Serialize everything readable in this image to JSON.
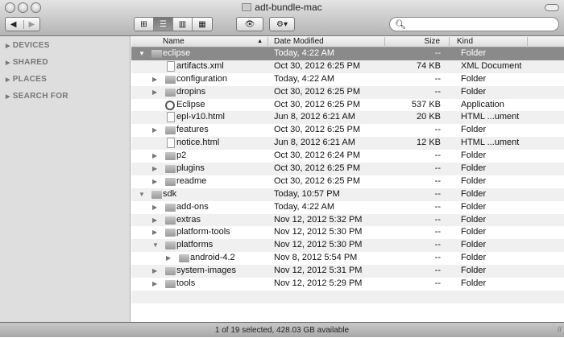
{
  "window": {
    "title": "adt-bundle-mac"
  },
  "toolbar": {
    "back": "◀",
    "forward": "▶",
    "view_icon": "⊞",
    "view_list": "☰",
    "view_column": "▥",
    "view_coverflow": "▦",
    "quicklook": "👁",
    "action": "⚙▾",
    "search_placeholder": "",
    "search_value": ""
  },
  "sidebar": {
    "sections": [
      "DEVICES",
      "SHARED",
      "PLACES",
      "SEARCH FOR"
    ]
  },
  "columns": {
    "name": "Name",
    "date": "Date Modified",
    "size": "Size",
    "kind": "Kind"
  },
  "rows": [
    {
      "name": "eclipse",
      "date": "Today, 4:22 AM",
      "size": "--",
      "kind": "Folder",
      "level": 0,
      "type": "folder",
      "disclosure": "open",
      "selected": true
    },
    {
      "name": "artifacts.xml",
      "date": "Oct 30, 2012 6:25 PM",
      "size": "74 KB",
      "kind": "XML Document",
      "level": 1,
      "type": "file"
    },
    {
      "name": "configuration",
      "date": "Today, 4:22 AM",
      "size": "--",
      "kind": "Folder",
      "level": 1,
      "type": "folder",
      "disclosure": "closed"
    },
    {
      "name": "dropins",
      "date": "Oct 30, 2012 6:25 PM",
      "size": "--",
      "kind": "Folder",
      "level": 1,
      "type": "folder",
      "disclosure": "closed"
    },
    {
      "name": "Eclipse",
      "date": "Oct 30, 2012 6:25 PM",
      "size": "537 KB",
      "kind": "Application",
      "level": 1,
      "type": "app"
    },
    {
      "name": "epl-v10.html",
      "date": "Jun 8, 2012 6:21 AM",
      "size": "20 KB",
      "kind": "HTML ...ument",
      "level": 1,
      "type": "file"
    },
    {
      "name": "features",
      "date": "Oct 30, 2012 6:25 PM",
      "size": "--",
      "kind": "Folder",
      "level": 1,
      "type": "folder",
      "disclosure": "closed"
    },
    {
      "name": "notice.html",
      "date": "Jun 8, 2012 6:21 AM",
      "size": "12 KB",
      "kind": "HTML ...ument",
      "level": 1,
      "type": "file"
    },
    {
      "name": "p2",
      "date": "Oct 30, 2012 6:24 PM",
      "size": "--",
      "kind": "Folder",
      "level": 1,
      "type": "folder",
      "disclosure": "closed"
    },
    {
      "name": "plugins",
      "date": "Oct 30, 2012 6:25 PM",
      "size": "--",
      "kind": "Folder",
      "level": 1,
      "type": "folder",
      "disclosure": "closed"
    },
    {
      "name": "readme",
      "date": "Oct 30, 2012 6:25 PM",
      "size": "--",
      "kind": "Folder",
      "level": 1,
      "type": "folder",
      "disclosure": "closed"
    },
    {
      "name": "sdk",
      "date": "Today, 10:57 PM",
      "size": "--",
      "kind": "Folder",
      "level": 0,
      "type": "folder",
      "disclosure": "open"
    },
    {
      "name": "add-ons",
      "date": "Today, 4:22 AM",
      "size": "--",
      "kind": "Folder",
      "level": 1,
      "type": "folder",
      "disclosure": "closed"
    },
    {
      "name": "extras",
      "date": "Nov 12, 2012 5:32 PM",
      "size": "--",
      "kind": "Folder",
      "level": 1,
      "type": "folder",
      "disclosure": "closed"
    },
    {
      "name": "platform-tools",
      "date": "Nov 12, 2012 5:30 PM",
      "size": "--",
      "kind": "Folder",
      "level": 1,
      "type": "folder",
      "disclosure": "closed"
    },
    {
      "name": "platforms",
      "date": "Nov 12, 2012 5:30 PM",
      "size": "--",
      "kind": "Folder",
      "level": 1,
      "type": "folder",
      "disclosure": "open"
    },
    {
      "name": "android-4.2",
      "date": "Nov 8, 2012 5:54 PM",
      "size": "--",
      "kind": "Folder",
      "level": 2,
      "type": "folder",
      "disclosure": "closed"
    },
    {
      "name": "system-images",
      "date": "Nov 12, 2012 5:31 PM",
      "size": "--",
      "kind": "Folder",
      "level": 1,
      "type": "folder",
      "disclosure": "closed"
    },
    {
      "name": "tools",
      "date": "Nov 12, 2012 5:29 PM",
      "size": "--",
      "kind": "Folder",
      "level": 1,
      "type": "folder",
      "disclosure": "closed"
    }
  ],
  "status": {
    "text": "1 of 19 selected, 428.03 GB available"
  }
}
